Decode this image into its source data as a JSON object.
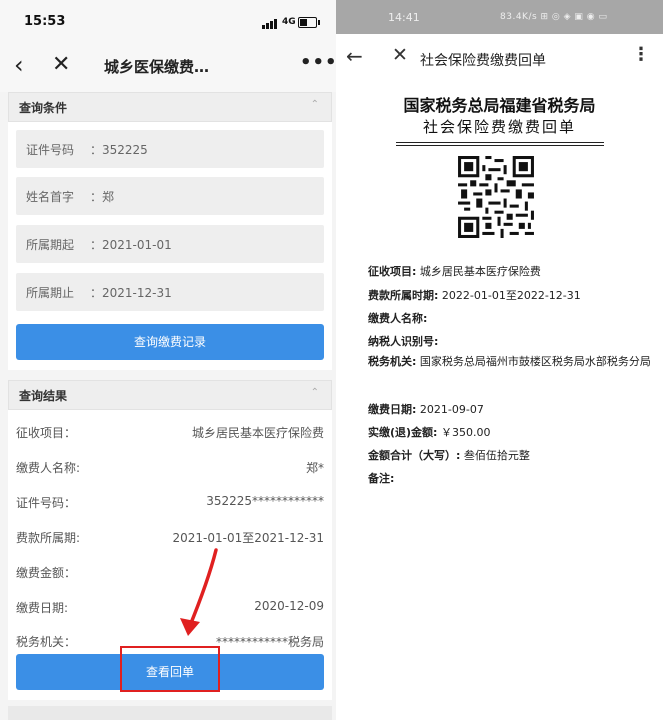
{
  "left": {
    "status_time": "15:53",
    "status_net": "4G",
    "nav_title": "城乡医保缴费…",
    "nav_more": "•••",
    "query_section": "查询条件",
    "query_fields": [
      {
        "label": "证件号码",
        "value": "：352225"
      },
      {
        "label": "姓名首字",
        "value": "：郑"
      },
      {
        "label": "所属期起",
        "value": "：2021-01-01"
      },
      {
        "label": "所属期止",
        "value": "：2021-12-31"
      }
    ],
    "query_button": "查询缴费记录",
    "result_section": "查询结果",
    "results": [
      {
        "label": "征收项目：",
        "value": "城乡居民基本医疗保险费"
      },
      {
        "label": "缴费人名称:",
        "value": "郑*"
      },
      {
        "label": "证件号码：",
        "value": "352225************"
      },
      {
        "label": "费款所属期:",
        "value": "2021-01-01至2021-12-31"
      },
      {
        "label": "缴费金额：",
        "value": ""
      },
      {
        "label": "缴费日期:",
        "value": "2020-12-09"
      },
      {
        "label": "税务机关：",
        "value": "************税务局"
      }
    ],
    "view_button": "查看回单"
  },
  "right": {
    "status_time": "14:41",
    "status_right": "83.4K/s ⊞ ◎ ◈ ▣ ◉ ▭",
    "nav_title": "社会保险费缴费回单",
    "doc_org": "国家税务总局福建省税务局",
    "doc_title": "社会保险费缴费回单",
    "fields": [
      {
        "label": "征收项目:",
        "value": "城乡居民基本医疗保险费"
      },
      {
        "label": "费款所属时期:",
        "value": "2022-01-01至2022-12-31"
      },
      {
        "label": "缴费人名称:",
        "value": ""
      },
      {
        "label": "纳税人识别号:",
        "value": ""
      },
      {
        "label": "税务机关:",
        "value": "国家税务总局福州市鼓楼区税务局水部税务分局"
      },
      {
        "label": "缴费日期:",
        "value": "2021-09-07"
      },
      {
        "label": "实缴(退)金额:",
        "value": "￥350.00"
      },
      {
        "label": "金额合计（大写）:",
        "value": "叁佰伍拾元整"
      },
      {
        "label": "备注:",
        "value": ""
      }
    ]
  },
  "colors": {
    "accent": "#3b8fe6",
    "highlight": "#e02020"
  },
  "icons": [
    "back-arrow-icon",
    "close-icon",
    "more-icon",
    "chevron-up-icon",
    "qr-code-icon",
    "signal-icon",
    "battery-icon"
  ]
}
